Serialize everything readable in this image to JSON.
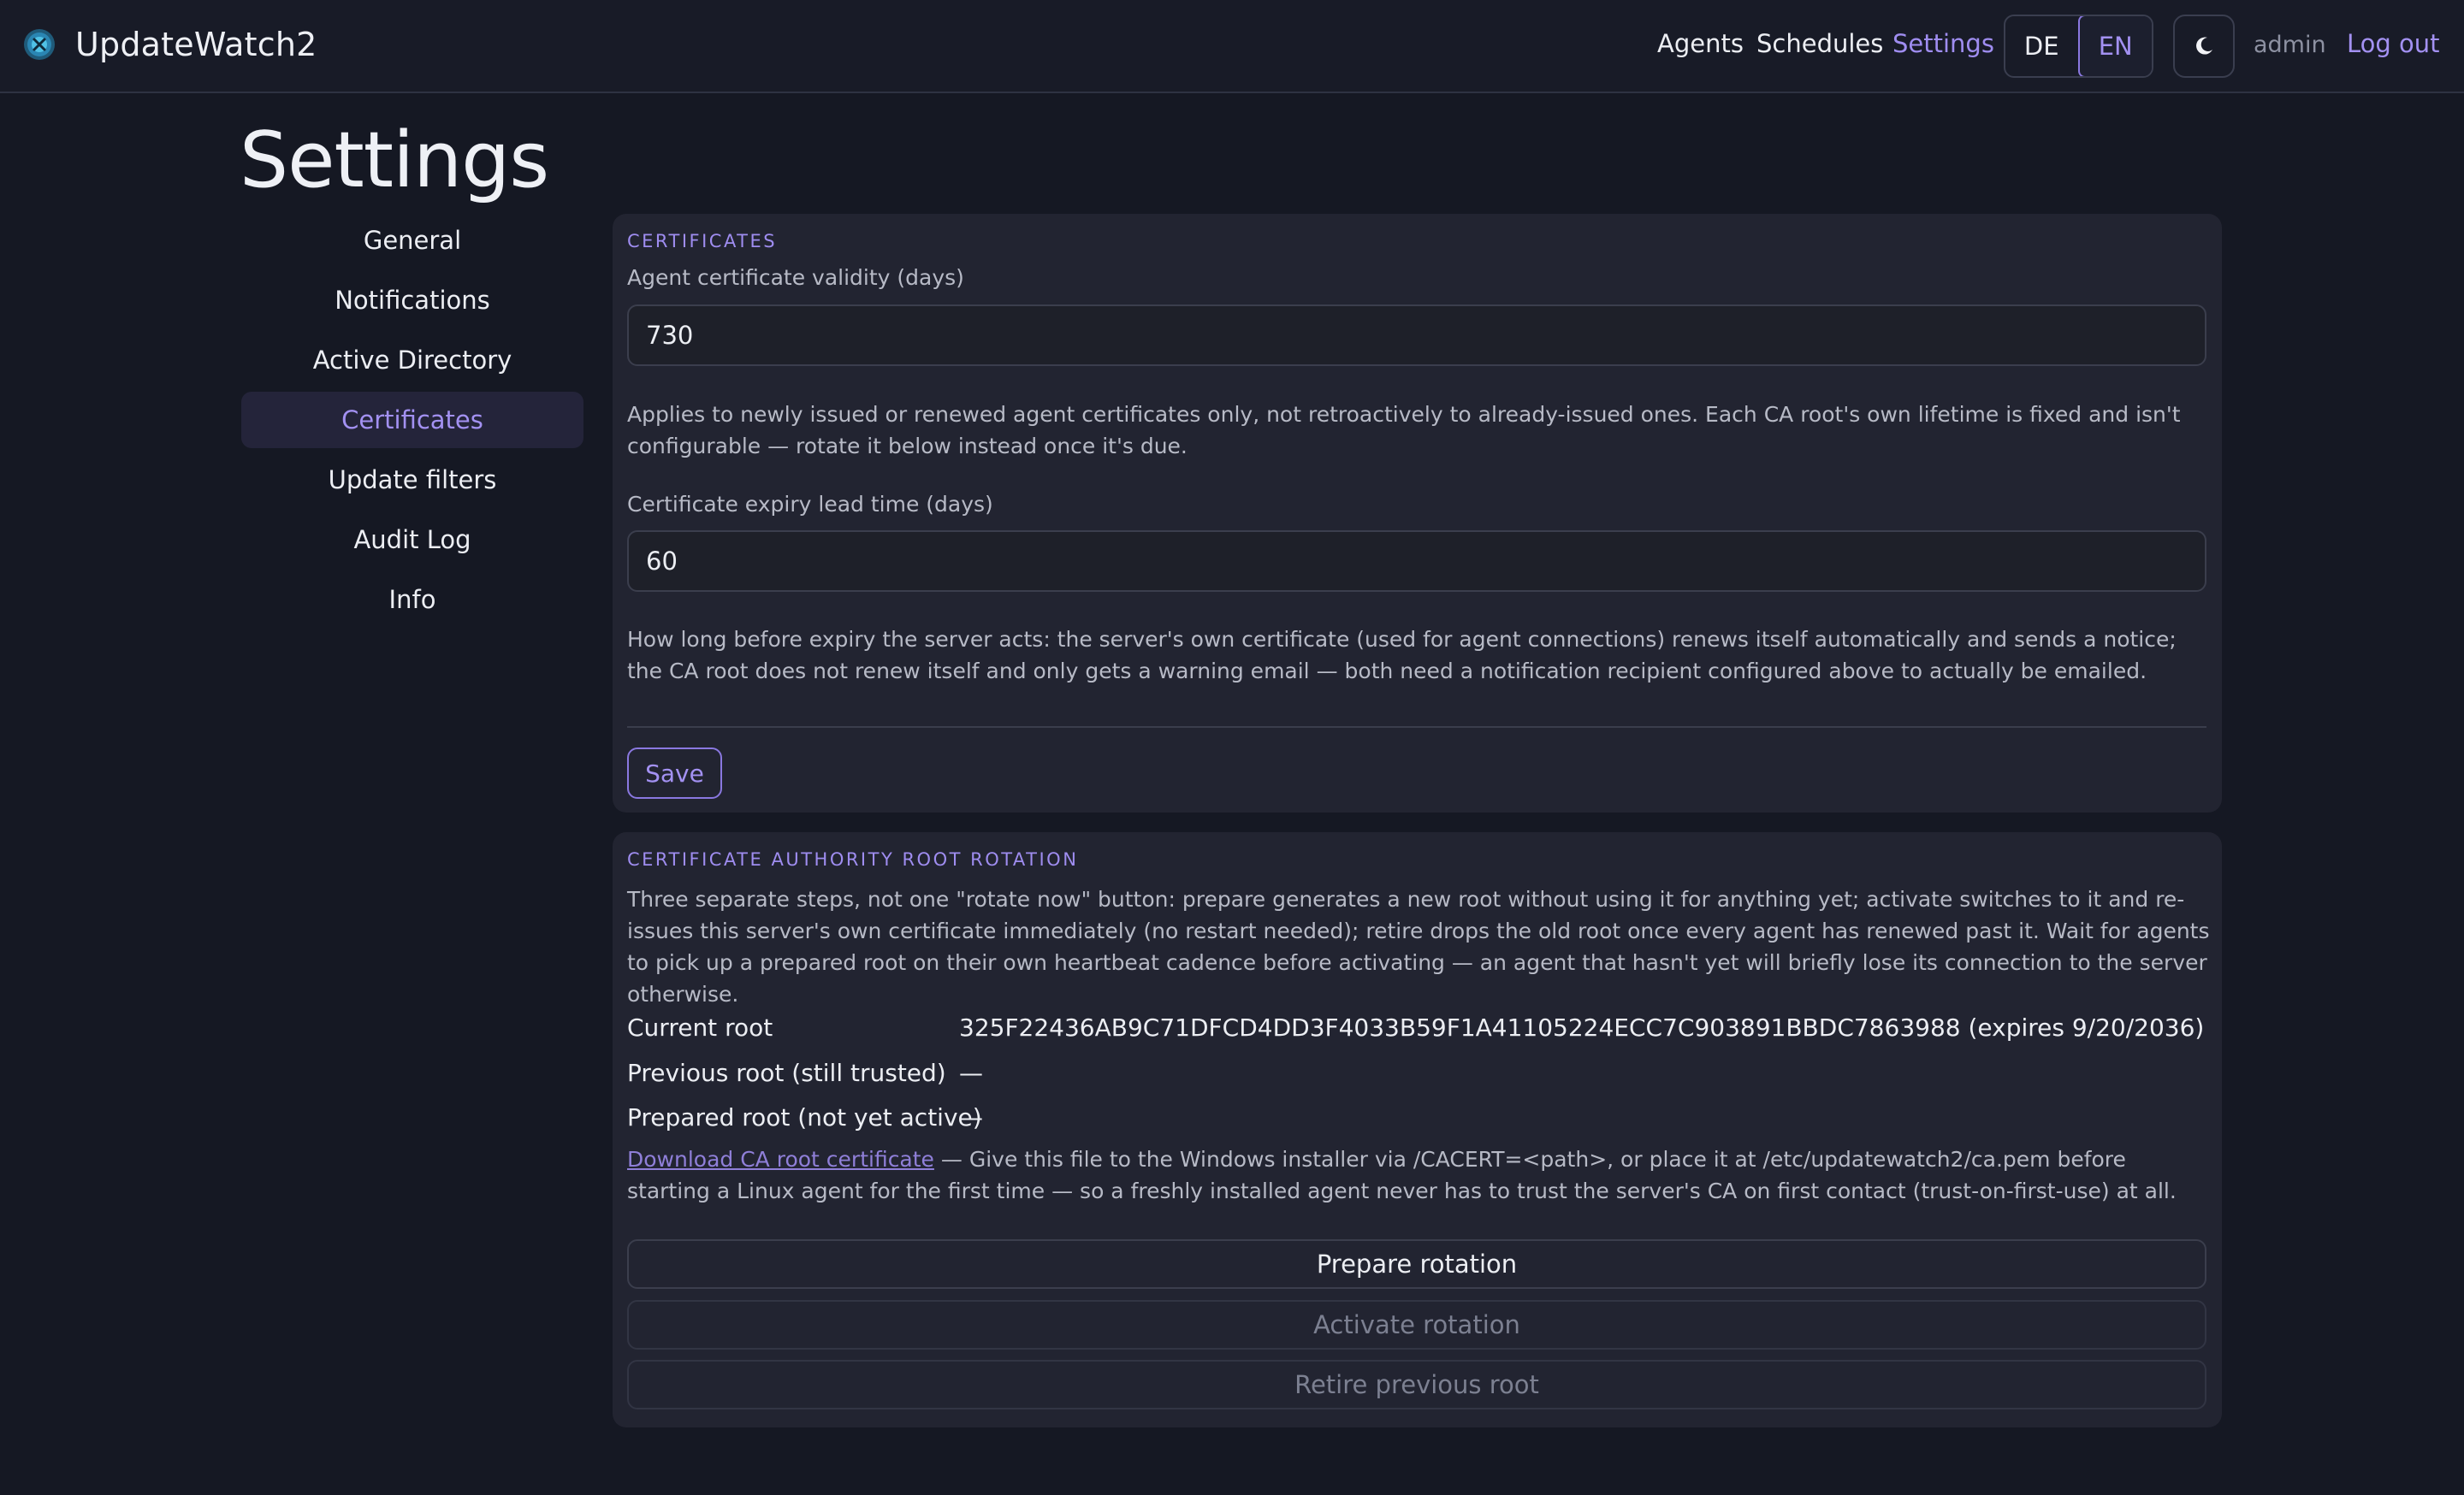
{
  "header": {
    "app_title": "UpdateWatch2",
    "logo_icon": "update-watch-logo-icon",
    "nav": {
      "agents": "Agents",
      "schedules": "Schedules",
      "settings": "Settings"
    },
    "languages": [
      "DE",
      "EN"
    ],
    "active_language": "EN",
    "theme_icon": "moon-icon",
    "user": "admin",
    "logout": "Log out"
  },
  "page": {
    "title": "Settings"
  },
  "sidebar": {
    "items": [
      {
        "label": "General"
      },
      {
        "label": "Notifications"
      },
      {
        "label": "Active Directory"
      },
      {
        "label": "Certificates",
        "active": true
      },
      {
        "label": "Update filters"
      },
      {
        "label": "Audit Log"
      },
      {
        "label": "Info"
      }
    ]
  },
  "certificates": {
    "section_title": "CERTIFICATES",
    "validity_label": "Agent certificate validity (days)",
    "validity_value": "730",
    "validity_help": "Applies to newly issued or renewed agent certificates only, not retroactively to already-issued ones. Each CA root's own lifetime is fixed and isn't configurable — rotate it below instead once it's due.",
    "lead_label": "Certificate expiry lead time (days)",
    "lead_value": "60",
    "lead_help": "How long before expiry the server acts: the server's own certificate (used for agent connections) renews itself automatically and sends a notice; the CA root does not renew itself and only gets a warning email — both need a notification recipient configured above to actually be emailed.",
    "save_label": "Save"
  },
  "rotation": {
    "section_title": "CERTIFICATE AUTHORITY ROOT ROTATION",
    "description": "Three separate steps, not one \"rotate now\" button: prepare generates a new root without using it for anything yet; activate switches to it and re-issues this server's own certificate immediately (no restart needed); retire drops the old root once every agent has renewed past it. Wait for agents to pick up a prepared root on their own heartbeat cadence before activating — an agent that hasn't yet will briefly lose its connection to the server otherwise.",
    "current_root_label": "Current root",
    "current_root_value": "325F22436AB9C71DFCD4DD3F4033B59F1A41105224ECC7C903891BBDC7863988 (expires 9/20/2036)",
    "previous_root_label": "Previous root (still trusted)",
    "previous_root_value": "—",
    "prepared_root_label": "Prepared root (not yet active)",
    "prepared_root_value": "—",
    "download_link": "Download CA root certificate",
    "download_text": " — Give this file to the Windows installer via /CACERT=<path>, or place it at /etc/updatewatch2/ca.pem before starting a Linux agent for the first time — so a freshly installed agent never has to trust the server's CA on first contact (trust-on-first-use) at all.",
    "prepare_label": "Prepare rotation",
    "activate_label": "Activate rotation",
    "retire_label": "Retire previous root"
  },
  "colors": {
    "accent": "#9f8df0",
    "background": "#151823",
    "panel": "#222431"
  }
}
